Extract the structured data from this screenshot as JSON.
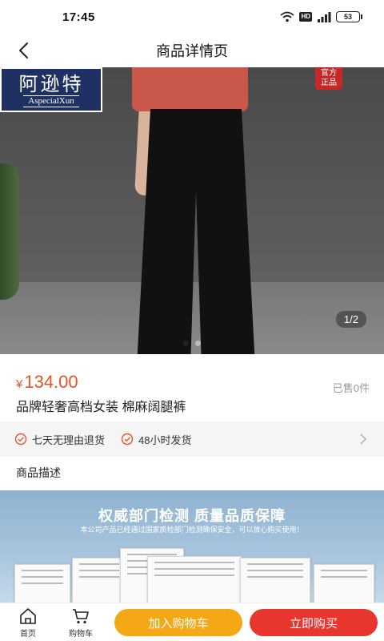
{
  "status_bar": {
    "time": "17:45",
    "battery": "53",
    "hd_label": "HD"
  },
  "nav": {
    "title": "商品详情页"
  },
  "gallery": {
    "brand_name": "阿逊特",
    "brand_en": "AspecialXun",
    "badge": "官方正品",
    "counter": "1/2",
    "current": 1,
    "total": 2
  },
  "product": {
    "currency": "¥",
    "price": "134.00",
    "sold": "已售0件",
    "title": "品牌轻奢高档女装 棉麻阔腿裤"
  },
  "services": [
    {
      "label": "七天无理由退货",
      "icon": "check-circle-icon"
    },
    {
      "label": "48小时发货",
      "icon": "check-circle-icon"
    }
  ],
  "description": {
    "heading": "商品描述",
    "banner_title": "权威部门检测 质量品质保障",
    "banner_subtitle": "本公司产品已经通过国家质检部门检测确保安全，可以放心购买使用！"
  },
  "bottom_bar": {
    "home_label": "首页",
    "cart_label": "购物车",
    "add_to_cart": "加入购物车",
    "buy_now": "立即购买"
  },
  "colors": {
    "price": "#e2542a",
    "cart_button": "#f5a815",
    "buy_button": "#e8362f",
    "brand_bg": "#1f3163"
  }
}
